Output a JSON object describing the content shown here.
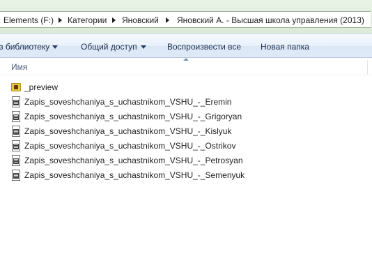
{
  "address_bar": {
    "crumbs": [
      "Elements (F:)",
      "Категории",
      "Яновский",
      "Яновский А. - Высшая школа управления (2013)"
    ]
  },
  "toolbar": {
    "add_to_library": "з библиотеку",
    "share": "Общий доступ",
    "play_all": "Воспроизвести все",
    "new_folder": "Новая папка"
  },
  "columns": {
    "name": "Имя"
  },
  "files": [
    {
      "name": "_preview",
      "icon": "folder-icon"
    },
    {
      "name": "Zapis_soveshchaniya_s_uchastnikom_VSHU_-_Eremin",
      "icon": "video-file-icon"
    },
    {
      "name": "Zapis_soveshchaniya_s_uchastnikom_VSHU_-_Grigoryan",
      "icon": "video-file-icon"
    },
    {
      "name": "Zapis_soveshchaniya_s_uchastnikom_VSHU_-_Kislyuk",
      "icon": "video-file-icon"
    },
    {
      "name": "Zapis_soveshchaniya_s_uchastnikom_VSHU_-_Ostrikov",
      "icon": "video-file-icon"
    },
    {
      "name": "Zapis_soveshchaniya_s_uchastnikom_VSHU_-_Petrosyan",
      "icon": "video-file-icon"
    },
    {
      "name": "Zapis_soveshchaniya_s_uchastnikom_VSHU_-_Semenyuk",
      "icon": "video-file-icon"
    }
  ],
  "colors": {
    "folder": "#e9c44d",
    "toolbar_text": "#1e2f4d",
    "header_text": "#4c607a"
  }
}
